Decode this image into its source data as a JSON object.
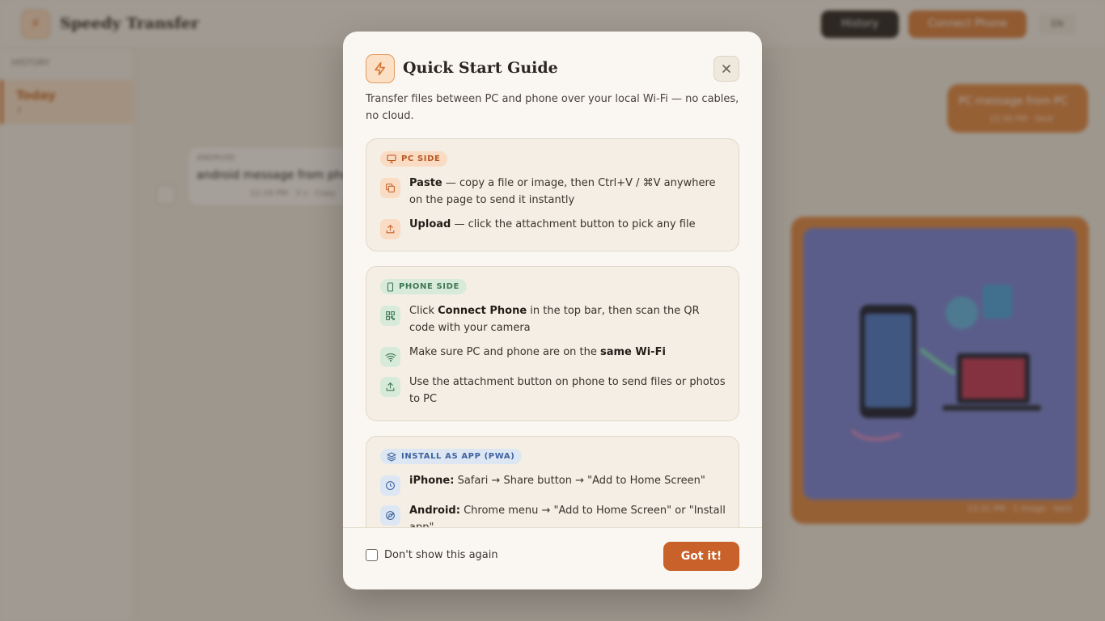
{
  "app": {
    "title": "Speedy Transfer",
    "history_label": "History",
    "connect_label": "Connect Phone",
    "lang_label": "EN"
  },
  "sidebar": {
    "header": "HISTORY",
    "items": [
      {
        "title": "Today",
        "sub": "3"
      }
    ]
  },
  "chat": {
    "incoming": {
      "sender": "ANDROID",
      "text": "android message from phone",
      "time": "12:29 PM · 3 s · Copy"
    },
    "outgoing": {
      "text": "PC message from PC",
      "time": "12:30 PM · Sent"
    },
    "image_time": "12:31 PM · 1 image · Sent"
  },
  "modal": {
    "title": "Quick Start Guide",
    "description": "Transfer files between PC and phone over your local Wi-Fi — no cables, no cloud.",
    "pc": {
      "badge": "PC SIDE",
      "items": [
        {
          "icon": "copy-icon",
          "bold": "Paste",
          "text": " — copy a file or image, then Ctrl+V / ⌘V anywhere on the page to send it instantly"
        },
        {
          "icon": "upload-icon",
          "bold": "Upload",
          "text": " — click the attachment button to pick any file"
        }
      ]
    },
    "phone": {
      "badge": "PHONE SIDE",
      "items": [
        {
          "icon": "qr-code-icon",
          "pre": "Click ",
          "bold": "Connect Phone",
          "text": " in the top bar, then scan the QR code with your camera"
        },
        {
          "icon": "wifi-icon",
          "pre": "Make sure PC and phone are on the ",
          "bold": "same Wi-Fi",
          "text": ""
        },
        {
          "icon": "upload-icon",
          "pre": "Use the attachment button on phone to send files or photos to PC",
          "bold": "",
          "text": ""
        }
      ]
    },
    "pwa": {
      "badge": "INSTALL AS APP (PWA)",
      "items": [
        {
          "icon": "safari-compass-icon",
          "bold": "iPhone:",
          "text": " Safari → Share button → \"Add to Home Screen\""
        },
        {
          "icon": "chrome-icon",
          "bold": "Android:",
          "text": " Chrome menu → \"Add to Home Screen\" or \"Install app\""
        }
      ]
    },
    "dont_show_label": "Don't show this again",
    "dont_show_checked": false,
    "got_it_label": "Got it!"
  },
  "colors": {
    "accent": "#c8612a",
    "pc": "#b85a22",
    "phone": "#3f7752",
    "pwa": "#3f62a0"
  }
}
